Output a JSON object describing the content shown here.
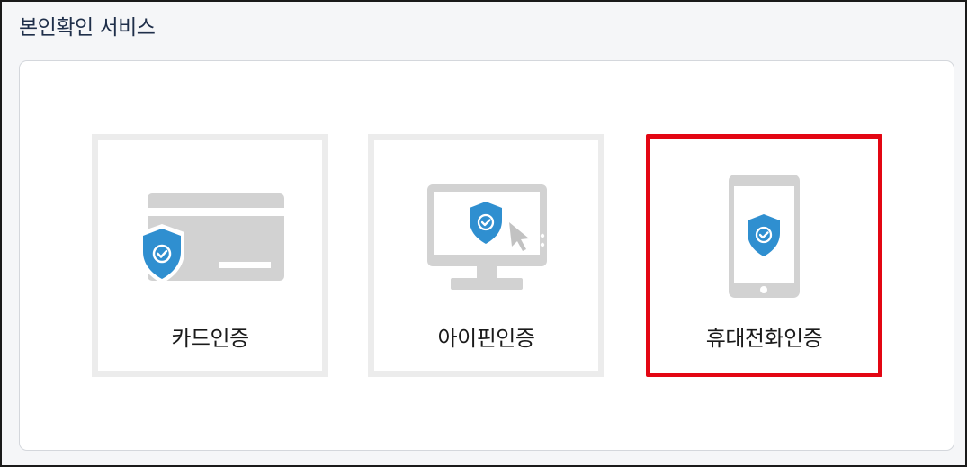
{
  "page": {
    "title": "본인확인 서비스"
  },
  "options": [
    {
      "label": "카드인증",
      "icon": "credit-card-shield-icon",
      "selected": false
    },
    {
      "label": "아이핀인증",
      "icon": "monitor-shield-cursor-icon",
      "selected": false
    },
    {
      "label": "휴대전화인증",
      "icon": "mobile-phone-shield-icon",
      "selected": true
    }
  ],
  "colors": {
    "accent_shield": "#2f8fd0",
    "device_gray": "#d2d2d2",
    "selected_border": "#e30613",
    "title_text": "#1f2f4a"
  }
}
